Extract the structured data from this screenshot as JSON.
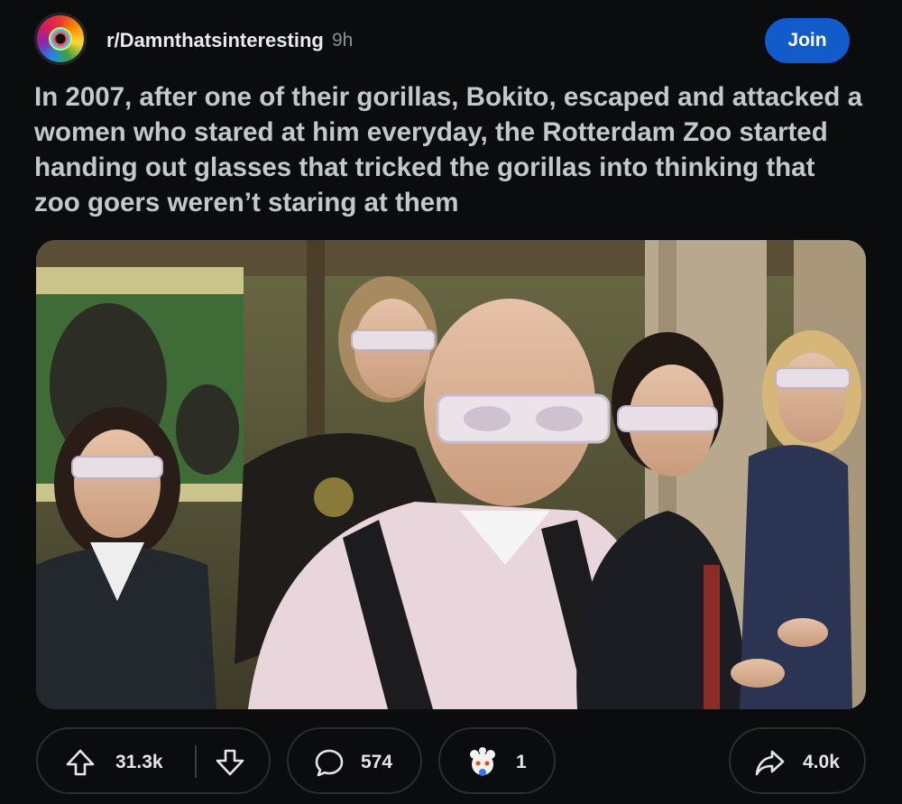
{
  "post": {
    "subreddit": "r/Damnthatsinteresting",
    "age": "9h",
    "join_label": "Join",
    "title": "In 2007, after one of their gorillas, Bokito, escaped and attacked a women who stared at him everyday, the Rotterdam Zoo started handing out glasses that tricked the gorillas into thinking that zoo goers weren’t staring at them"
  },
  "actions": {
    "upvotes": "31.3k",
    "comments": "574",
    "awards": "1",
    "shares": "4.0k"
  },
  "colors": {
    "background": "#0b0c0e",
    "join_button": "#115bca",
    "title_text": "#c3c8cc"
  },
  "icons": [
    "subreddit-avatar",
    "upvote-arrow-icon",
    "downvote-arrow-icon",
    "comment-bubble-icon",
    "award-icon",
    "share-arrow-icon"
  ]
}
